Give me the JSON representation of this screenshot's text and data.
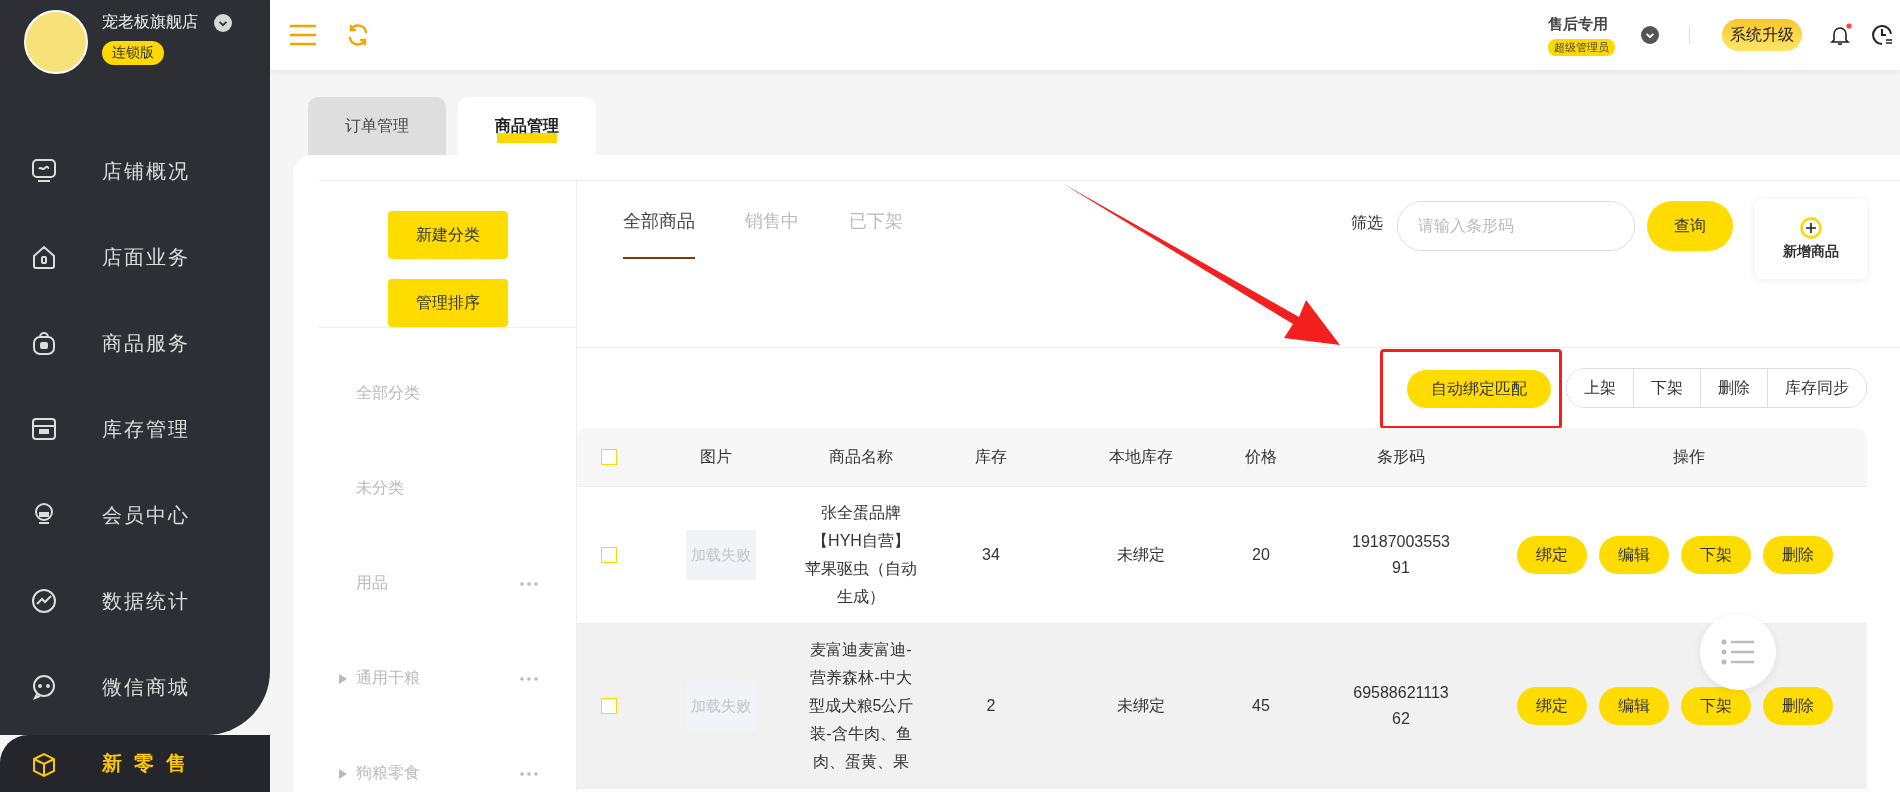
{
  "store": {
    "name": "宠老板旗舰店",
    "badge": "连锁版"
  },
  "sidebar": {
    "items": [
      {
        "label": "店铺概况",
        "selected": false
      },
      {
        "label": "店面业务",
        "selected": false
      },
      {
        "label": "商品服务",
        "selected": false
      },
      {
        "label": "库存管理",
        "selected": false
      },
      {
        "label": "会员中心",
        "selected": false
      },
      {
        "label": "数据统计",
        "selected": false
      },
      {
        "label": "微信商城",
        "selected": false
      },
      {
        "label": "新零售",
        "selected": true
      }
    ]
  },
  "header": {
    "user_name": "售后专用",
    "role_badge": "超级管理员",
    "upgrade_button": "系统升级",
    "has_unread": true
  },
  "tabs": [
    {
      "label": "订单管理",
      "selected": false
    },
    {
      "label": "商品管理",
      "selected": true
    }
  ],
  "left_panel": {
    "buttons": [
      "新建分类",
      "管理排序"
    ],
    "categories": [
      {
        "label": "全部分类",
        "has_children": false,
        "has_menu": false
      },
      {
        "label": "未分类",
        "has_children": false,
        "has_menu": false
      },
      {
        "label": "用品",
        "has_children": false,
        "has_menu": true
      },
      {
        "label": "通用干粮",
        "has_children": true,
        "has_menu": true
      },
      {
        "label": "狗粮零食",
        "has_children": true,
        "has_menu": true
      }
    ]
  },
  "sub_tabs": [
    {
      "label": "全部商品",
      "selected": true
    },
    {
      "label": "销售中",
      "selected": false
    },
    {
      "label": "已下架",
      "selected": false
    }
  ],
  "filter": {
    "label": "筛选",
    "placeholder": "请输入条形码",
    "query_button": "查询",
    "add_button": "新增商品"
  },
  "actions": {
    "auto_bind": "自动绑定匹配",
    "group": [
      "上架",
      "下架",
      "删除",
      "库存同步"
    ]
  },
  "table": {
    "select_all": false,
    "columns": [
      "图片",
      "商品名称",
      "库存",
      "本地库存",
      "价格",
      "条形码",
      "操作"
    ],
    "rows": [
      {
        "selected": false,
        "highlighted": false,
        "image": "加载失败",
        "name": "张全蛋品牌【HYH自营】苹果驱虫（自动生成）",
        "stock": "34",
        "local_stock": "未绑定",
        "price": "20",
        "barcode": "1918700355391",
        "actions": [
          "绑定",
          "编辑",
          "下架",
          "删除"
        ]
      },
      {
        "selected": false,
        "highlighted": true,
        "image": "加载失败",
        "name": "麦富迪麦富迪-营养森林-中大型成犬粮5公斤装-含牛肉、鱼肉、蛋黄、果",
        "stock": "2",
        "local_stock": "未绑定",
        "price": "45",
        "barcode": "6958862111362",
        "actions": [
          "绑定",
          "编辑",
          "下架",
          "删除"
        ]
      }
    ]
  }
}
